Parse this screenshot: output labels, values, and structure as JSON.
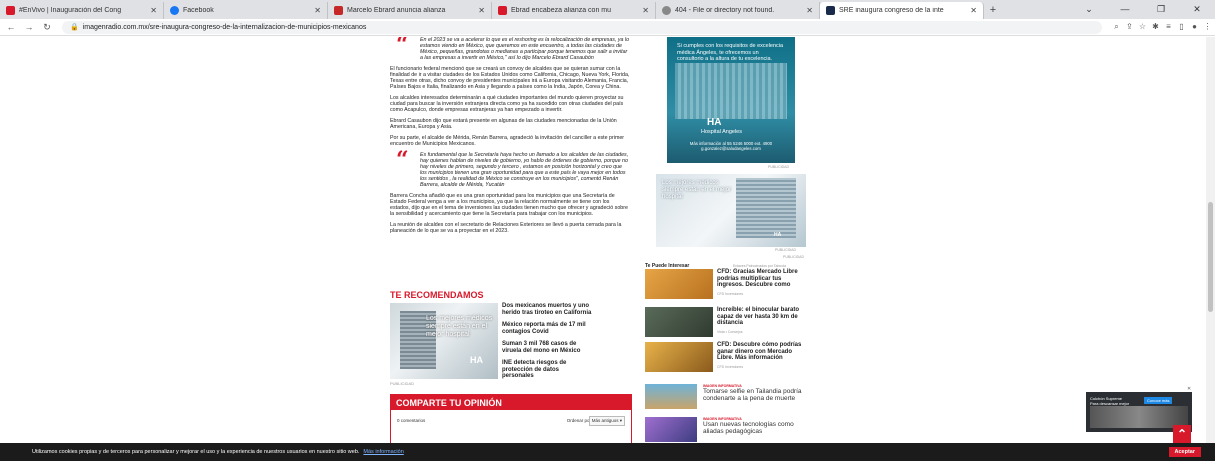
{
  "browser": {
    "tabs": [
      {
        "title": "#EnVivo | Inauguración del Cong",
        "color": "#d7192b"
      },
      {
        "title": "Facebook",
        "color": "#1877f2"
      },
      {
        "title": "Marcelo Ebrard anuncia alianza",
        "color": "#c62828"
      },
      {
        "title": "Ebrad encabeza alianza con mu",
        "color": "#d7192b"
      },
      {
        "title": "404 - File or directory not found.",
        "color": "#888888"
      },
      {
        "title": "SRE inaugura congreso de la inte",
        "color": "#1a2a4a"
      }
    ],
    "url": "imagenradio.com.mx/sre-inaugura-congreso-de-la-internalizacion-de-municipios-mexicanos",
    "new_tab": "+"
  },
  "article": {
    "quote1": "En el 2023 se va a acelerar lo que es el reshoring es la relocalización de empresas, ya lo estamos viendo en México, que queremos en este encuentro, a todas las ciudades de México, pequeñas, grandotas o medianas a participar porque tenemos que salir a invitar a las empresas a invertir en México,\" así lo dijo Marcelo Ebrard Casaubón",
    "p1": "El funcionario federal mencionó que se creará un convoy de alcaldes que se quieran sumar con la finalidad de ir a visitar ciudades de los Estados Unidos como California, Chicago, Nueva York, Florida, Texas entre otras, dicho convoy de presidentes municipales irá a Europa visitando Alemania, Francia, Países Bajos e Italia, finalizando en Asia y llegando a países como la India, Japón, Corea y China.",
    "p2": "Los alcaldes interesados determinarán a qué ciudades importantes del mundo quieren proyectar su ciudad para buscar la inversión extranjera directa como ya ha sucedido con otras ciudades del país como Acapulco, donde empresas extranjeras ya han empezado a invertir.",
    "p3": "Ebrard Casaubon dijo que estará presente en algunas de las ciudades mencionadas de la Unión Americana, Europa y Asia.",
    "p4": "Por su parte, el alcalde de Mérida, Renán Barrera, agradeció la invitación del canciller a este primer encuentro de Municipios Mexicanos.",
    "quote2": "Es fundamental que la Secretaría haya hecho un llamado a los alcaldes de las ciudades, hay quienes hablan de niveles de gobierno, yo hablo de órdenes de gobierno, porque no hay niveles de primero, segundo y tercero , estamos en posición horizontal y creo que los municipios tienen una gran oportunidad para que a este país le vaya mejor en todos los sentidos , la realidad de México se construye en los municipios\", comentó Renán Barrera, alcalde de Mérida, Yucatán",
    "p5": "Barrera Concha añadió que es una gran oportunidad para los municipios que una Secretaría de Estado Federal venga a ver a los municipios, ya que la relación normalmente se tiene con los estados, dijo que en el tema de inversiones las ciudades tienen mucho que ofrecer y agradeció sobre la sensibilidad y acercamiento que tiene la Secretaría para trabajar con los municipios.",
    "p6": "La reunión de alcaldes con el secretario de Relaciones Exteriores se llevó a puerta cerrada para la planeación de lo que se va a proyectar en el 2023."
  },
  "recommend": {
    "title": "TE RECOMENDAMOS",
    "ad_text": "Los mejores médicos siempre están en el mejor hospital",
    "ad_logo": "HA",
    "ad_label": "PUBLICIDAD",
    "items": [
      "Dos mexicanos muertos y uno herido tras tiroteo en California",
      "México reporta más de 17 mil contagios Covid",
      "Suman 3 mil 768 casos de viruela del mono en México",
      "INE detecta riesgos de protección de datos personales"
    ]
  },
  "opinion": {
    "title": "COMPARTE TU OPINIÓN",
    "count": "0 comentarios",
    "order_label": "Ordenar por",
    "order_value": "Más antiguos ▾"
  },
  "sidebar": {
    "ad1_top": "Si cumples con los requisitos de excelencia médica Ángeles, te ofrecemos un consultorio a la altura de tu excelencia.",
    "ad1_logo": "HA",
    "ad1_name": "Hospital Angeles",
    "ad1_info": "Más información al 55 5246 5000 ext. 4900 g.gonzalez@saludangeles.com",
    "ad1_label": "PUBLICIDAD",
    "ad2_text": "Los mejores médicos siempre están en el mejor hospital",
    "ad2_logo": "HA",
    "ad2_label": "PUBLICIDAD",
    "ad2_label2": "PUBLICIDAD",
    "tpi_title": "Te Puede Interesar",
    "tpi_by": "Enlaces Patrocinados por Taboola",
    "tpi": [
      {
        "text": "CFD: Gracias Mercado Libre podrías multiplicar tus ingresos. Descubre como",
        "src": "CFD Inversiones",
        "c1": "#e6a546",
        "c2": "#b8711f"
      },
      {
        "text": "Increíble: el binocular barato capaz de ver hasta 30 km de distancia",
        "src": "Vista • Consejos",
        "c1": "#5a6b5a",
        "c2": "#2f3a2f"
      },
      {
        "text": "CFD: Descubre cómo podrías ganar dinero con Mercado Libre. Más información",
        "src": "CFD Inversiones",
        "c1": "#e8b24a",
        "c2": "#8a5a1c"
      }
    ],
    "news": [
      {
        "cat": "IMAGEN INFORMATIVA",
        "text": "Tomarse selfie en Tailandia podría condenarte a la pena de muerte",
        "c1": "#6fb3d9",
        "c2": "#c9a46a"
      },
      {
        "cat": "IMAGEN INFORMATIVA",
        "text": "Usan nuevas tecnologías como aliadas pedagógicas",
        "c1": "#a06fd1",
        "c2": "#3d3d80"
      }
    ]
  },
  "float_ad": {
    "text": "Colchón Supreme Para descansar mejor",
    "btn": "Conoce más",
    "close": "✕"
  },
  "cookie": {
    "text": "Utilizamos cookies propias y de terceros para personalizar y mejorar el uso y la experiencia de nuestros usuarios en nuestro sitio web.",
    "link": "Más información",
    "accept": "Aceptar"
  }
}
